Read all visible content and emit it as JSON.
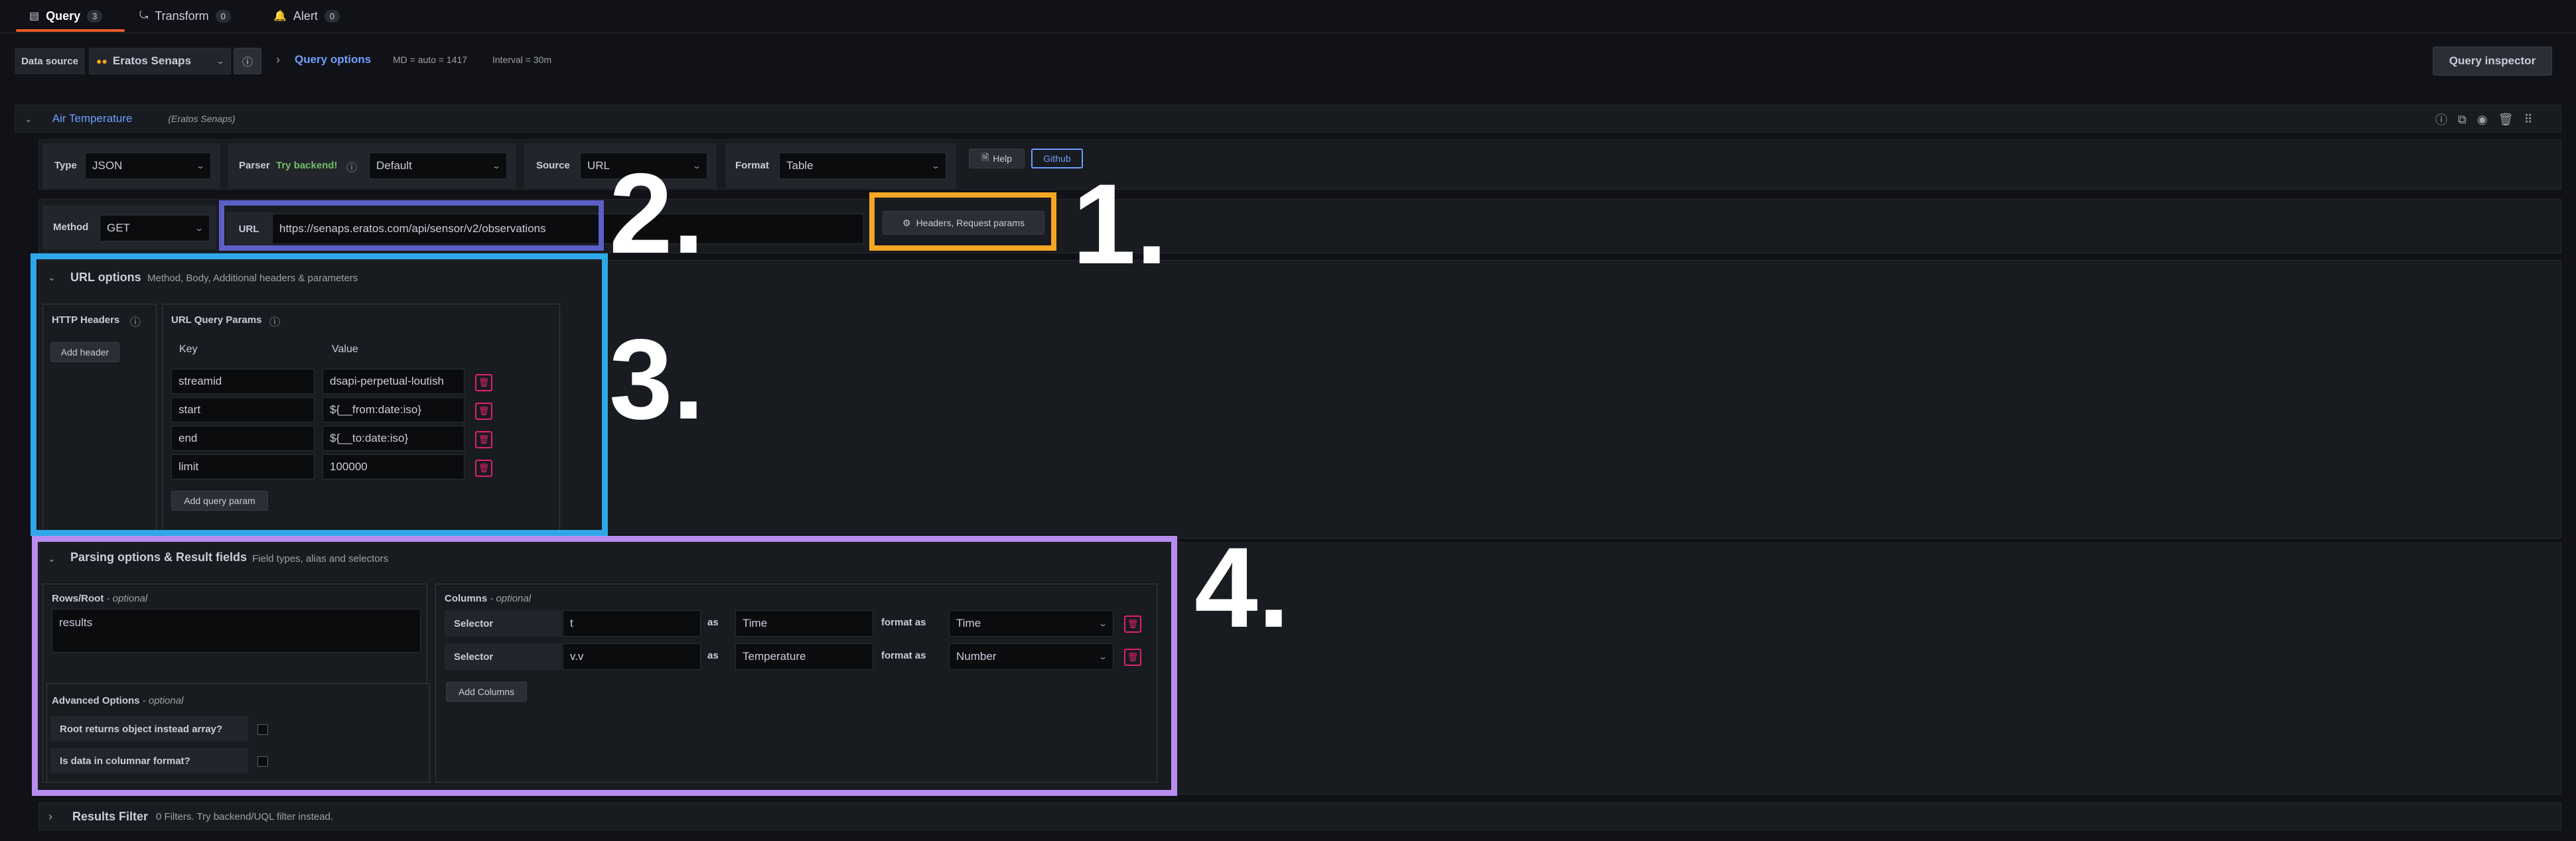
{
  "tabs": [
    {
      "label": "Query",
      "count": "3",
      "icon": "database-icon"
    },
    {
      "label": "Transform",
      "count": "0",
      "icon": "transform-icon"
    },
    {
      "label": "Alert",
      "count": "0",
      "icon": "bell-icon"
    }
  ],
  "toolbar": {
    "datasource_label": "Data source",
    "datasource_value": "Eratos Senaps",
    "query_options_label": "Query options",
    "md_text": "MD = auto = 1417",
    "interval_text": "Interval = 30m",
    "query_inspector_label": "Query inspector"
  },
  "query_row": {
    "name": "Air Temperature",
    "datasource": "(Eratos Senaps)"
  },
  "settings": {
    "type_label": "Type",
    "type_value": "JSON",
    "parser_label": "Parser",
    "try_backend": "Try backend!",
    "parser_value": "Default",
    "source_label": "Source",
    "source_value": "URL",
    "format_label": "Format",
    "format_value": "Table",
    "help_label": "Help",
    "github_label": "Github"
  },
  "request": {
    "method_label": "Method",
    "method_value": "GET",
    "url_label": "URL",
    "url_value": "https://senaps.eratos.com/api/sensor/v2/observations",
    "headers_button": "Headers, Request params"
  },
  "url_options": {
    "title": "URL options",
    "subtitle": "Method, Body, Additional headers & parameters",
    "http_headers_label": "HTTP Headers",
    "add_header_label": "Add header",
    "query_params_label": "URL Query Params",
    "key_header": "Key",
    "value_header": "Value",
    "params": [
      {
        "key": "streamid",
        "value": "dsapi-perpetual-loutish"
      },
      {
        "key": "start",
        "value": "${__from:date:iso}"
      },
      {
        "key": "end",
        "value": "${__to:date:iso}"
      },
      {
        "key": "limit",
        "value": "100000"
      }
    ],
    "add_query_param_label": "Add query param"
  },
  "parsing": {
    "title": "Parsing options & Result fields",
    "subtitle": "Field types, alias and selectors",
    "rows_root_label": "Rows/Root",
    "optional_text": "- optional",
    "rows_root_value": "results",
    "advanced_label": "Advanced Options",
    "root_object_label": "Root returns object instead array?",
    "columnar_label": "Is data in columnar format?",
    "columns_label": "Columns",
    "columns": [
      {
        "selector_label": "Selector",
        "selector": "t",
        "as_label": "as",
        "alias": "Time",
        "format_label": "format as",
        "format": "Time"
      },
      {
        "selector_label": "Selector",
        "selector": "v.v",
        "as_label": "as",
        "alias": "Temperature",
        "format_label": "format as",
        "format": "Number"
      }
    ],
    "add_columns_label": "Add Columns"
  },
  "results_filter": {
    "title": "Results Filter",
    "subtitle": "0 Filters. Try backend/UQL filter instead."
  },
  "annotations": [
    {
      "label": "1.",
      "color": "#f5a623"
    },
    {
      "label": "2.",
      "color": "#5b5fc7"
    },
    {
      "label": "3.",
      "color": "#2ea8e8"
    },
    {
      "label": "4.",
      "color": "#b98cf0"
    }
  ]
}
